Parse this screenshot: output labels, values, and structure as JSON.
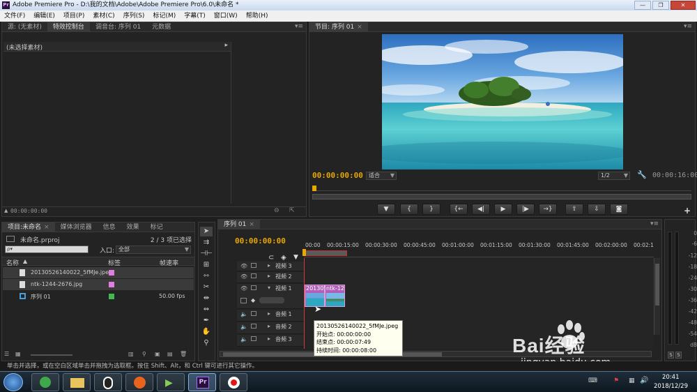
{
  "window": {
    "title": "Adobe Premiere Pro - D:\\我的文档\\Adobe\\Adobe Premiere Pro\\6.0\\未命名 *",
    "app_icon": "Pr"
  },
  "menu": [
    "文件(F)",
    "编辑(E)",
    "项目(P)",
    "素材(C)",
    "序列(S)",
    "标记(M)",
    "字幕(T)",
    "窗口(W)",
    "帮助(H)"
  ],
  "source_panel": {
    "tabs": [
      "源: (无素材)",
      "特效控制台",
      "调音台: 序列 01",
      "元数据"
    ],
    "active_tab": 1,
    "no_clip_label": "(未选择素材)",
    "timecode": "00:00:00:00"
  },
  "program_monitor": {
    "tab": "节目: 序列 01",
    "timecode_current": "00:00:00:00",
    "fit": "适合",
    "resolution": "1/2",
    "timecode_duration": "00:00:16:00",
    "transport_icons": [
      "marker-icon",
      "in-point-icon",
      "out-point-icon",
      "go-to-in-icon",
      "step-back-icon",
      "play-icon",
      "step-forward-icon",
      "go-to-out-icon",
      "lift-icon",
      "extract-icon",
      "export-frame-icon"
    ],
    "transport_glyphs": [
      "▼",
      "{",
      "}",
      "{←",
      "◀|",
      "▶",
      "|▶",
      "→}",
      "⇧",
      "⇩",
      "◙"
    ]
  },
  "project_panel": {
    "tabs": [
      "项目:未命名",
      "媒体浏览器",
      "信息",
      "效果",
      "标记"
    ],
    "project_file": "未命名.prproj",
    "selection_count": "2 / 3 项已选择",
    "search_placeholder": "ρ▾",
    "in_label": "入口:",
    "in_value": "全部",
    "columns": [
      "名称",
      "标签",
      "帧速率"
    ],
    "items": [
      {
        "name": "20130526140022_5fMJe.jpe",
        "label_color": "#e07ee0",
        "fps": ""
      },
      {
        "name": "ntk-1244-2676.jpg",
        "label_color": "#e07ee0",
        "fps": ""
      },
      {
        "name": "序列 01",
        "label_color": "#3fb950",
        "fps": "50.00 fps"
      }
    ]
  },
  "timeline": {
    "tab": "序列 01",
    "timecode": "00:00:00:00",
    "ruler": [
      "00:00",
      "00:00:15:00",
      "00:00:30:00",
      "00:00:45:00",
      "00:01:00:00",
      "00:01:15:00",
      "00:01:30:00",
      "00:01:45:00",
      "00:02:00:00",
      "00:02:1"
    ],
    "tracks": [
      "视频 3",
      "视频 2",
      "视频 1",
      "音频 1",
      "音频 2",
      "音频 3"
    ],
    "clips": [
      {
        "label": "201305",
        "track": "视频 1"
      },
      {
        "label": "ntk-12",
        "track": "视频 1"
      }
    ]
  },
  "tooltip": {
    "file": "20130526140022_5fMJe.jpeg",
    "start": "开始点: 00:00:00:00",
    "end": "结束点: 00:00:07:49",
    "duration": "持续时间: 00:00:08:00"
  },
  "audio_meter": {
    "labels": [
      "0",
      "-6",
      "-12",
      "-18",
      "-24",
      "-30",
      "-36",
      "-42",
      "-48",
      "-54",
      "dB"
    ],
    "solo_labels": [
      "S",
      "S"
    ]
  },
  "status_text": "单击并选择，或在空白区域单击并拖拽为选取框。按住 Shift、Alt，和 Ctrl 键可进行其它操作。",
  "taskbar": {
    "clock_time": "20:41",
    "clock_date": "2018/12/29"
  },
  "watermark": {
    "brand": "Bai经验",
    "url": "jingyan.baidu.com"
  },
  "colors": {
    "accent_timecode": "#e8a800",
    "playhead": "#d23c3c",
    "clip_pink": "#c070c0"
  }
}
